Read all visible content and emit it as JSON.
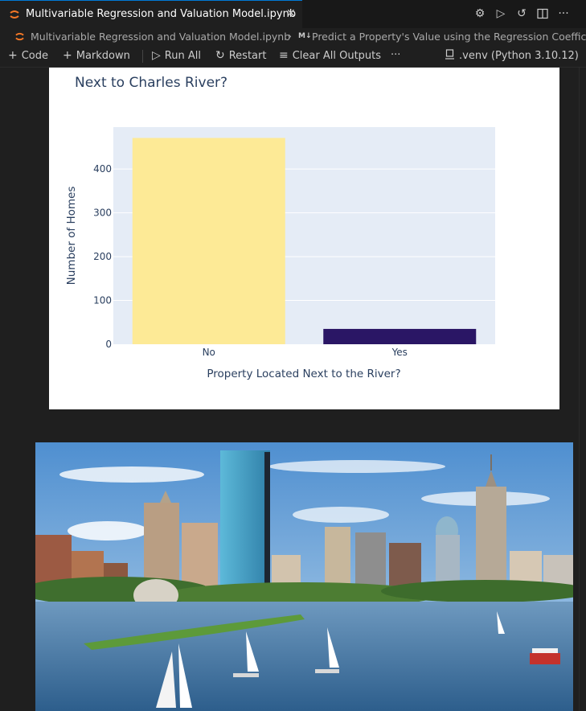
{
  "tab": {
    "title": "Multivariable Regression and Valuation Model.ipynb",
    "close": "✕"
  },
  "breadcrumb": {
    "file": "Multivariable Regression and Valuation Model.ipynb",
    "separator": "›",
    "cell_badge": "M↓",
    "cell": "Predict a Property's Value using the Regression Coeffic"
  },
  "toolbar": {
    "code": "Code",
    "markdown": "Markdown",
    "run_all": "Run All",
    "restart": "Restart",
    "clear_outputs": "Clear All Outputs",
    "more": "···",
    "kernel": ".venv (Python 3.10.12)"
  },
  "colors": {
    "accent": "#0078d4",
    "bar_no": "#fdea96",
    "bar_yes": "#2a1665",
    "plot_bg": "#e5ecf6"
  },
  "chart_data": {
    "type": "bar",
    "title": "Next to Charles River?",
    "xlabel": "Property Located Next to the River?",
    "ylabel": "Number of Homes",
    "categories": [
      "No",
      "Yes"
    ],
    "values": [
      471,
      35
    ],
    "yticks": [
      0,
      100,
      200,
      300,
      400
    ],
    "ylim": [
      0,
      495.8
    ],
    "grid": true,
    "legend": "none"
  }
}
